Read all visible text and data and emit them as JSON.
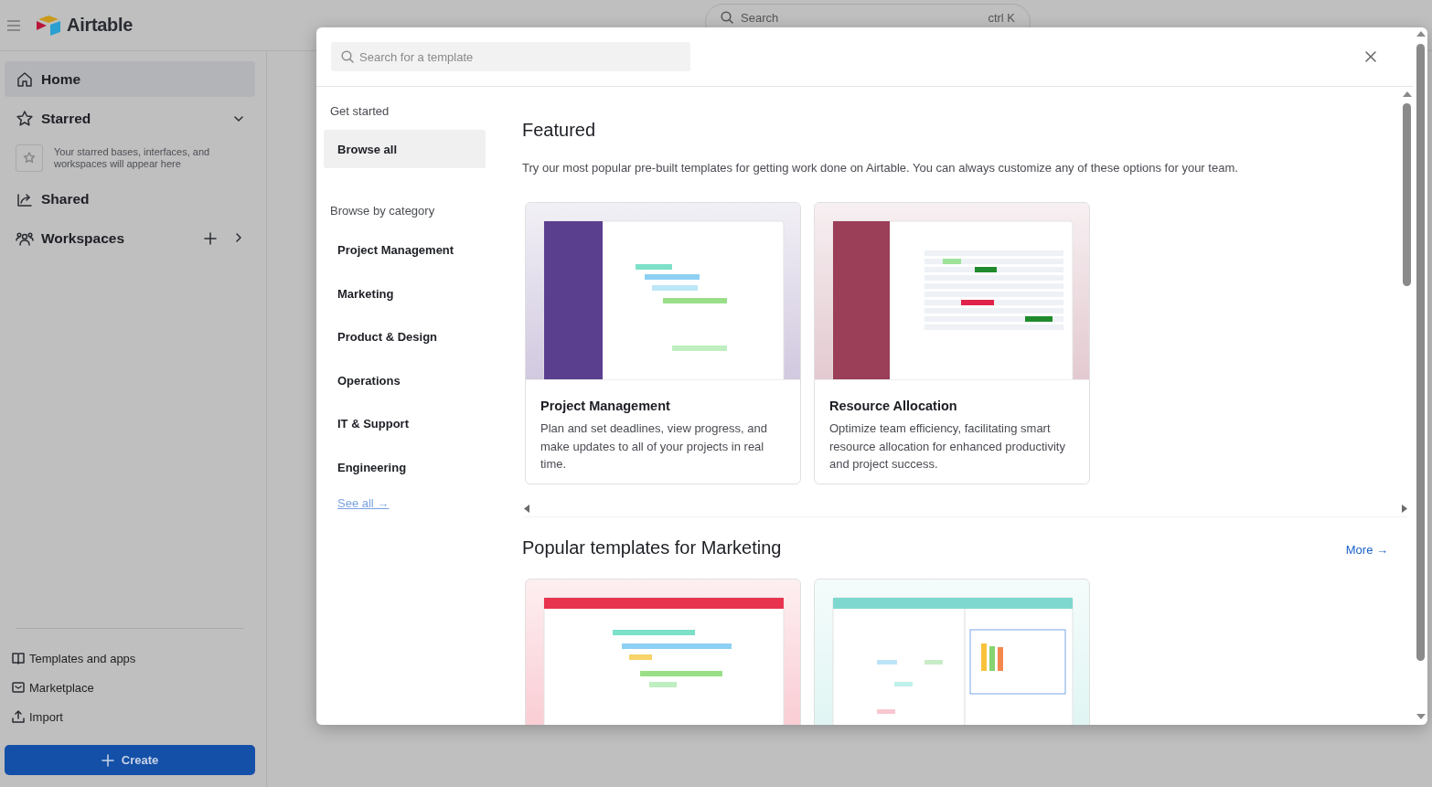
{
  "topbar": {
    "brand": "Airtable",
    "search_label": "Search",
    "search_shortcut": "ctrl K"
  },
  "sidebar": {
    "items": [
      {
        "label": "Home",
        "kind": "home",
        "selected": true
      },
      {
        "label": "Starred",
        "kind": "starred",
        "selected": false
      },
      {
        "label": "Shared",
        "kind": "shared",
        "selected": false
      },
      {
        "label": "Workspaces",
        "kind": "workspaces",
        "selected": false
      }
    ],
    "starred_hint": "Your starred bases, interfaces, and workspaces will appear here",
    "footer_items": [
      {
        "label": "Templates and apps",
        "kind": "book"
      },
      {
        "label": "Marketplace",
        "kind": "store"
      },
      {
        "label": "Import",
        "kind": "upload"
      }
    ],
    "create_button": "Create"
  },
  "modal": {
    "search": {
      "placeholder": "Search for a template"
    },
    "nav": {
      "get_started": "Get started",
      "browse_all": {
        "label": "Browse all",
        "selected": true
      },
      "category_heading": "Browse by category",
      "categories": [
        {
          "label": "Project Management",
          "selected": false
        },
        {
          "label": "Marketing",
          "selected": false
        },
        {
          "label": "Product & Design",
          "selected": false
        },
        {
          "label": "Operations",
          "selected": false
        },
        {
          "label": "IT & Support",
          "selected": false
        },
        {
          "label": "Engineering",
          "selected": false
        }
      ],
      "see_all": "See all →"
    },
    "featured": {
      "title": "Featured",
      "description": "Try our most popular pre-built templates for getting work done on Airtable. You can always customize any of these options for your team.",
      "templates": [
        {
          "title": "Project Management",
          "description": "Plan and set deadlines, view progress, and make updates to all of your projects in real time.",
          "color": "#5b3f8f",
          "kind": "gantt"
        },
        {
          "title": "Resource Allocation",
          "description": "Optimize team efficiency, facilitating smart resource allocation for enhanced productivity and project success.",
          "color": "#9a3f57",
          "kind": "grid"
        }
      ]
    },
    "marketing": {
      "title": "Popular templates for Marketing",
      "more": "More →",
      "templates": [
        {
          "color": "#e8334f",
          "kind": "gantt"
        },
        {
          "color": "#7fd8cf",
          "kind": "calendar"
        }
      ]
    }
  }
}
